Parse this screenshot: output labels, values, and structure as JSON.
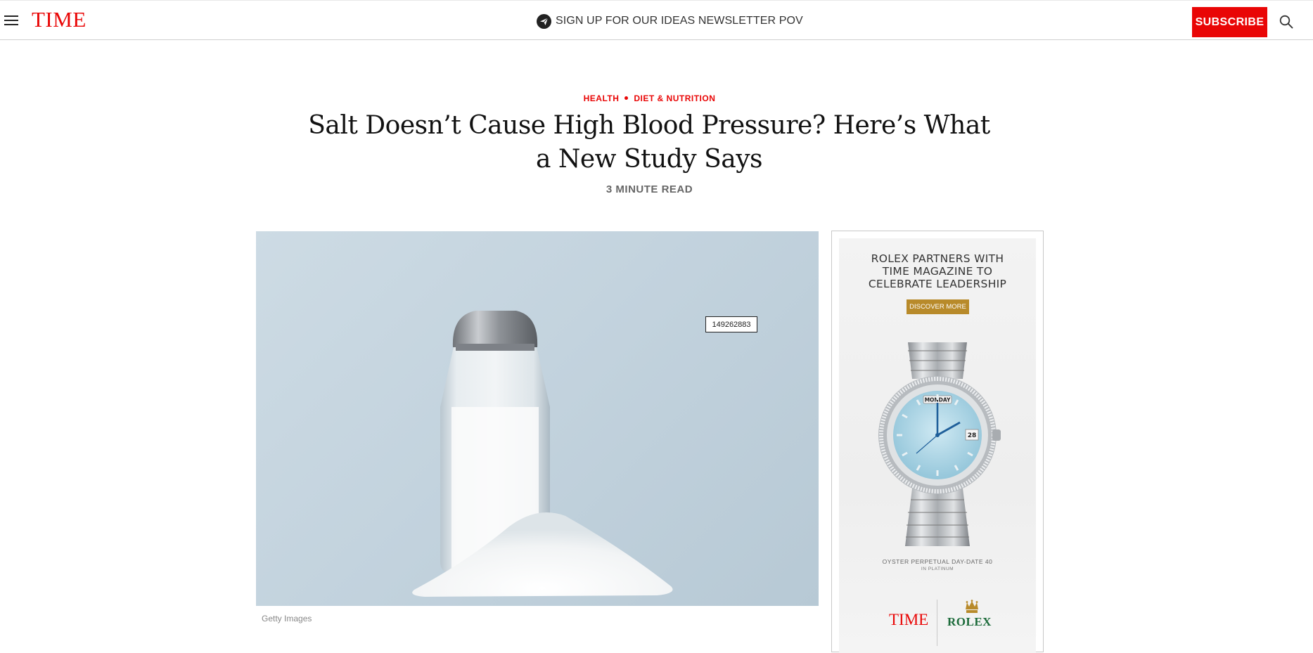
{
  "header": {
    "logo": "TIME",
    "newsletter_text": "SIGN UP FOR OUR IDEAS NEWSLETTER POV",
    "subscribe_label": "SUBSCRIBE"
  },
  "article": {
    "kicker": [
      "HEALTH",
      "DIET & NUTRITION"
    ],
    "headline": "Salt Doesn’t Cause High Blood Pressure? Here’s What a New Study Says",
    "read_time": "3 MINUTE READ",
    "image_tag": "149262883",
    "image_credit": "Getty Images"
  },
  "ad": {
    "headline_lines": [
      "ROLEX PARTNERS WITH",
      "TIME MAGAZINE TO",
      "CELEBRATE LEADERSHIP"
    ],
    "button_label": "DISCOVER MORE",
    "watch_day": "MONDAY",
    "watch_date": "28",
    "model": "OYSTER PERPETUAL DAY-DATE 40",
    "model_sub": "IN PLATINUM",
    "brand_time": "TIME",
    "brand_rolex": "ROLEX"
  },
  "colors": {
    "brand_red": "#e90606",
    "ad_gold": "#b88a2a",
    "rolex_green": "#1c6b3a"
  },
  "icons": [
    "menu-icon",
    "newsletter-icon",
    "search-icon",
    "rolex-crown-icon"
  ]
}
